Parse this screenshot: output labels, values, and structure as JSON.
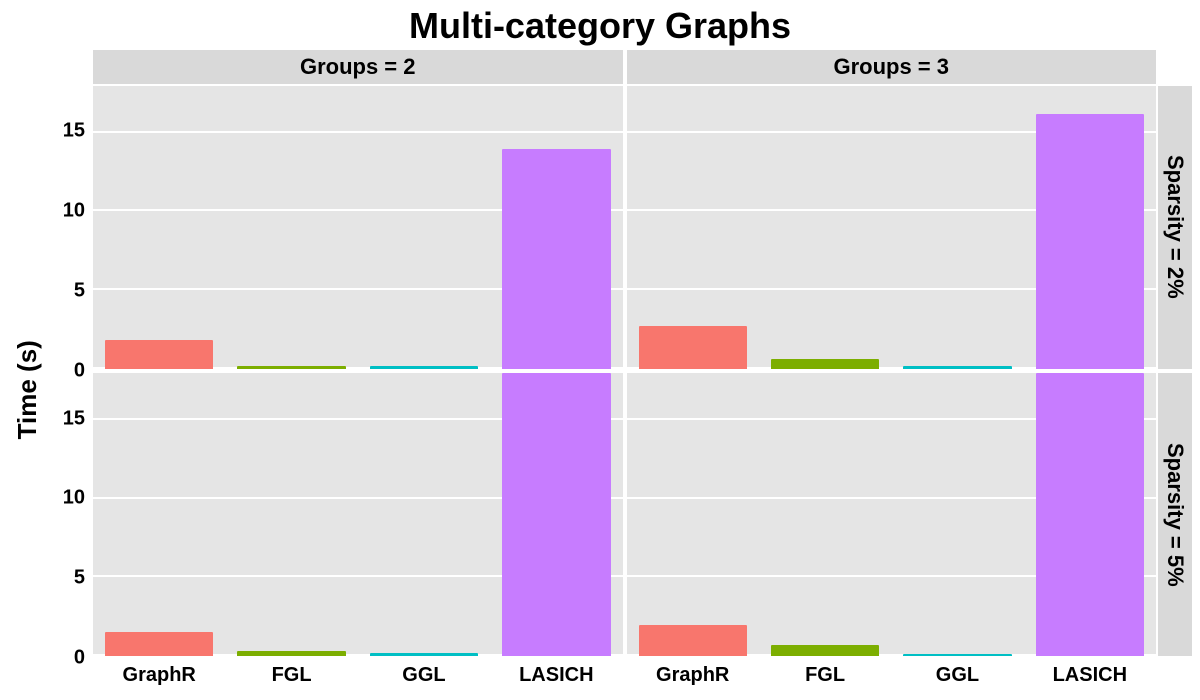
{
  "chart_data": {
    "type": "bar",
    "title": "Multi-category Graphs",
    "ylabel": "Time (s)",
    "xlabel": "",
    "ylim": [
      0,
      18
    ],
    "yticks": [
      0,
      5,
      10,
      15
    ],
    "categories": [
      "GraphR",
      "FGL",
      "GGL",
      "LASICH"
    ],
    "facet_cols": [
      {
        "label": "Groups = 2",
        "value": 2
      },
      {
        "label": "Groups = 3",
        "value": 3
      }
    ],
    "facet_rows": [
      {
        "label": "Sparsity = 2%",
        "value": "2%"
      },
      {
        "label": "Sparsity = 5%",
        "value": "5%"
      }
    ],
    "panels": [
      {
        "row": 0,
        "col": 0,
        "values": [
          1.8,
          0.2,
          0.15,
          14.0
        ]
      },
      {
        "row": 0,
        "col": 1,
        "values": [
          2.7,
          0.6,
          0.15,
          16.2
        ]
      },
      {
        "row": 1,
        "col": 0,
        "values": [
          1.5,
          0.3,
          0.2,
          18.0
        ]
      },
      {
        "row": 1,
        "col": 1,
        "values": [
          2.0,
          0.7,
          0.15,
          18.0
        ]
      }
    ],
    "colors": {
      "GraphR": "#f8766d",
      "FGL": "#7cae00",
      "GGL": "#00bfc4",
      "LASICH": "#c77cff"
    }
  }
}
